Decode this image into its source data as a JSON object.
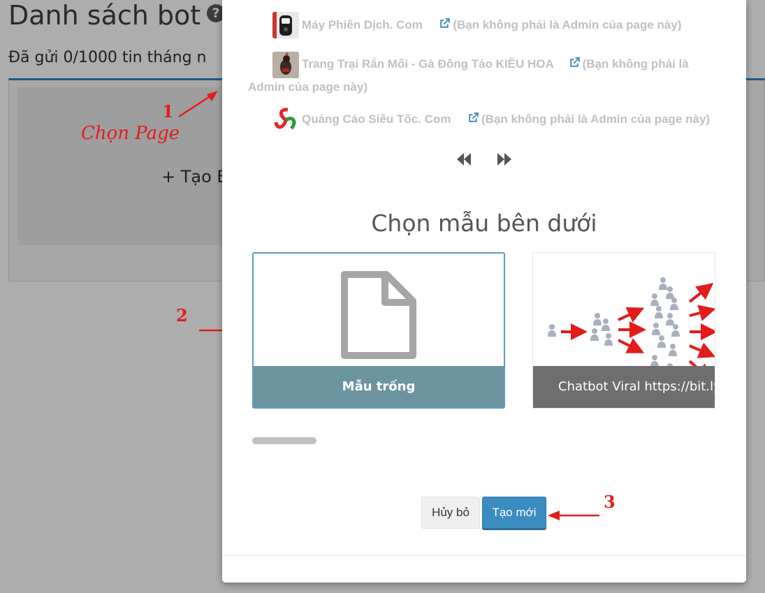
{
  "background": {
    "title": "Danh sách bot",
    "subtitle": "Đã gửi 0/1000 tin tháng n",
    "create_bot_label": "+ Tạo Bo"
  },
  "annotations": {
    "step1_number": "1",
    "step1_text": "Chọn Page",
    "step2_number": "2",
    "step3_number": "3",
    "arrow_color": "#e31b1b"
  },
  "modal": {
    "pages": [
      {
        "name": "Máy Phiên Dịch. Com",
        "note": "(Bạn không phải là Admin của page này)",
        "avatar_icon": "translator-device-avatar"
      },
      {
        "name": "Trang Trại Rắn Mối - Gà Đông Tảo KIỀU HOA",
        "note_line1": "(Bạn không phải là",
        "note_line2": "Admin của page này)",
        "avatar_icon": "rooster-avatar"
      },
      {
        "name": "Quảng Cáo Siêu Tốc. Com",
        "note": "(Bạn không phải là Admin của page này)",
        "avatar_icon": "colorful-swirl-logo"
      }
    ],
    "nav": {
      "prev_icon": "double-chevron-left-icon",
      "next_icon": "double-chevron-right-icon"
    },
    "choose_template_heading": "Chọn mẫu bên dưới",
    "templates": [
      {
        "label": "Mẫu trống",
        "icon": "blank-document-icon",
        "selected": true
      },
      {
        "label": "Chatbot Viral https://bit.ly/",
        "icon": "viral-network-illustration"
      }
    ],
    "buttons": {
      "cancel": "Hủy bỏ",
      "create": "Tạo mới"
    },
    "colors": {
      "primary": "#3a8cc1",
      "selected_border": "#5b9bc9",
      "blank_label_bg": "#6c949f"
    }
  }
}
